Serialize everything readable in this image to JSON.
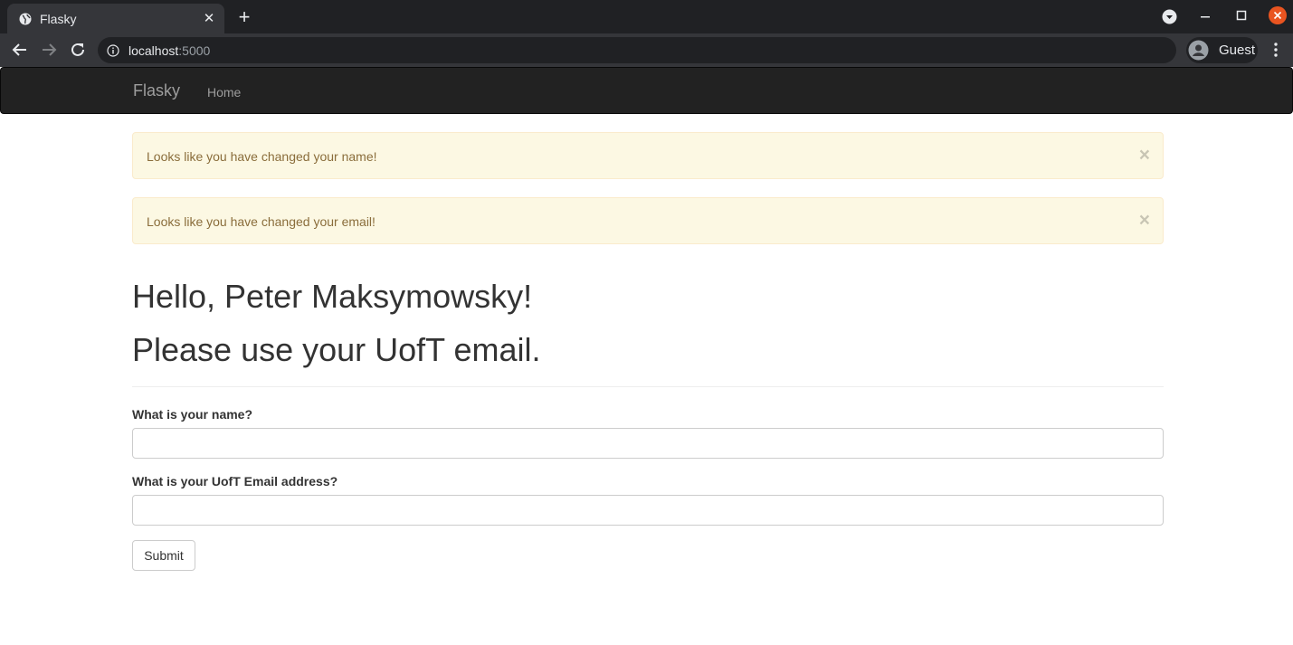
{
  "browser": {
    "tab": {
      "title": "Flasky"
    },
    "url": {
      "host": "localhost",
      "port": ":5000"
    },
    "profile": {
      "name": "Guest"
    }
  },
  "navbar": {
    "brand": "Flasky",
    "links": [
      "Home"
    ]
  },
  "alerts": [
    {
      "text": "Looks like you have changed your name!",
      "close": "×"
    },
    {
      "text": "Looks like you have changed your email!",
      "close": "×"
    }
  ],
  "header": {
    "greeting": "Hello, Peter Maksymowsky!",
    "notice": "Please use your UofT email."
  },
  "form": {
    "name_label": "What is your name?",
    "name_value": "",
    "email_label": "What is your UofT Email address?",
    "email_value": "",
    "submit_label": "Submit"
  },
  "colors": {
    "navbar": "#222222",
    "alert_bg": "#fcf8e3",
    "alert_text": "#8a6d3b",
    "window_close": "#e95420"
  }
}
